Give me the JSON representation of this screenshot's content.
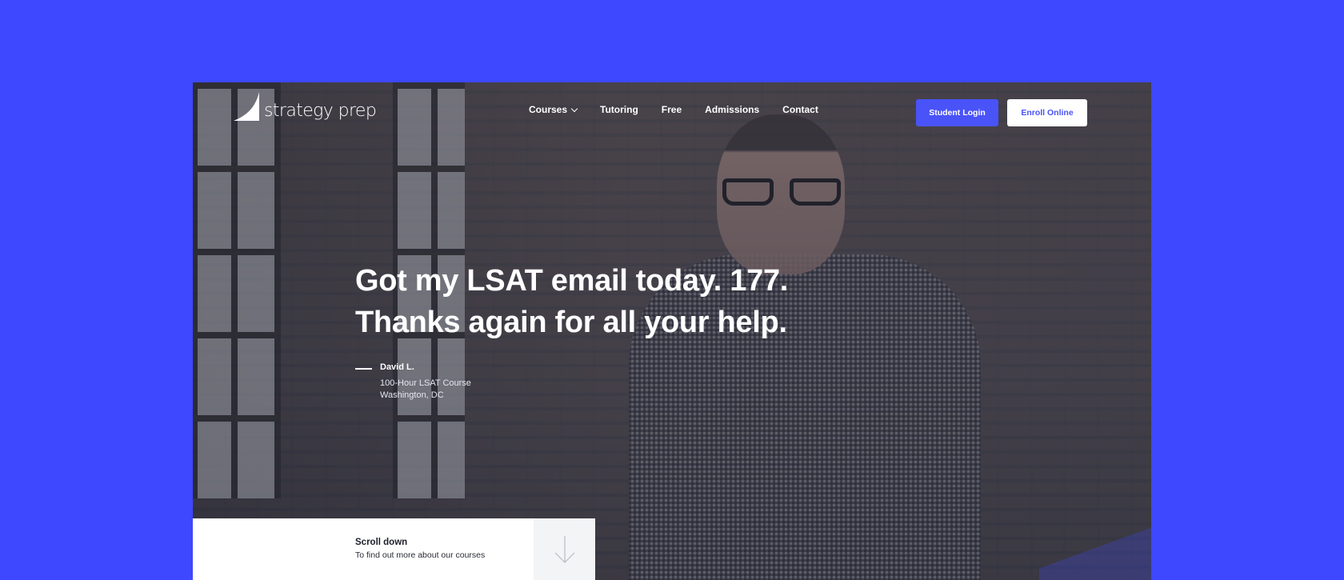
{
  "brand": {
    "name": "strategy prep"
  },
  "nav": {
    "items": [
      {
        "label": "Courses",
        "has_dropdown": true
      },
      {
        "label": "Tutoring"
      },
      {
        "label": "Free"
      },
      {
        "label": "Admissions"
      },
      {
        "label": "Contact"
      }
    ]
  },
  "buttons": {
    "student_login": "Student Login",
    "enroll_online": "Enroll Online"
  },
  "hero": {
    "quote_line1": "Got my LSAT email today. 177.",
    "quote_line2": "Thanks again for all your help.",
    "author": "David L.",
    "course": "100-Hour LSAT Course",
    "location": "Washington, DC"
  },
  "scroll": {
    "title": "Scroll down",
    "subtitle": "To find out more about our courses"
  },
  "colors": {
    "page_background": "#3d48ff",
    "accent": "#4a53f8",
    "white": "#ffffff"
  },
  "icons": {
    "logo": "sail-logo-icon",
    "dropdown": "chevron-down-icon",
    "scroll": "arrow-down-icon"
  }
}
